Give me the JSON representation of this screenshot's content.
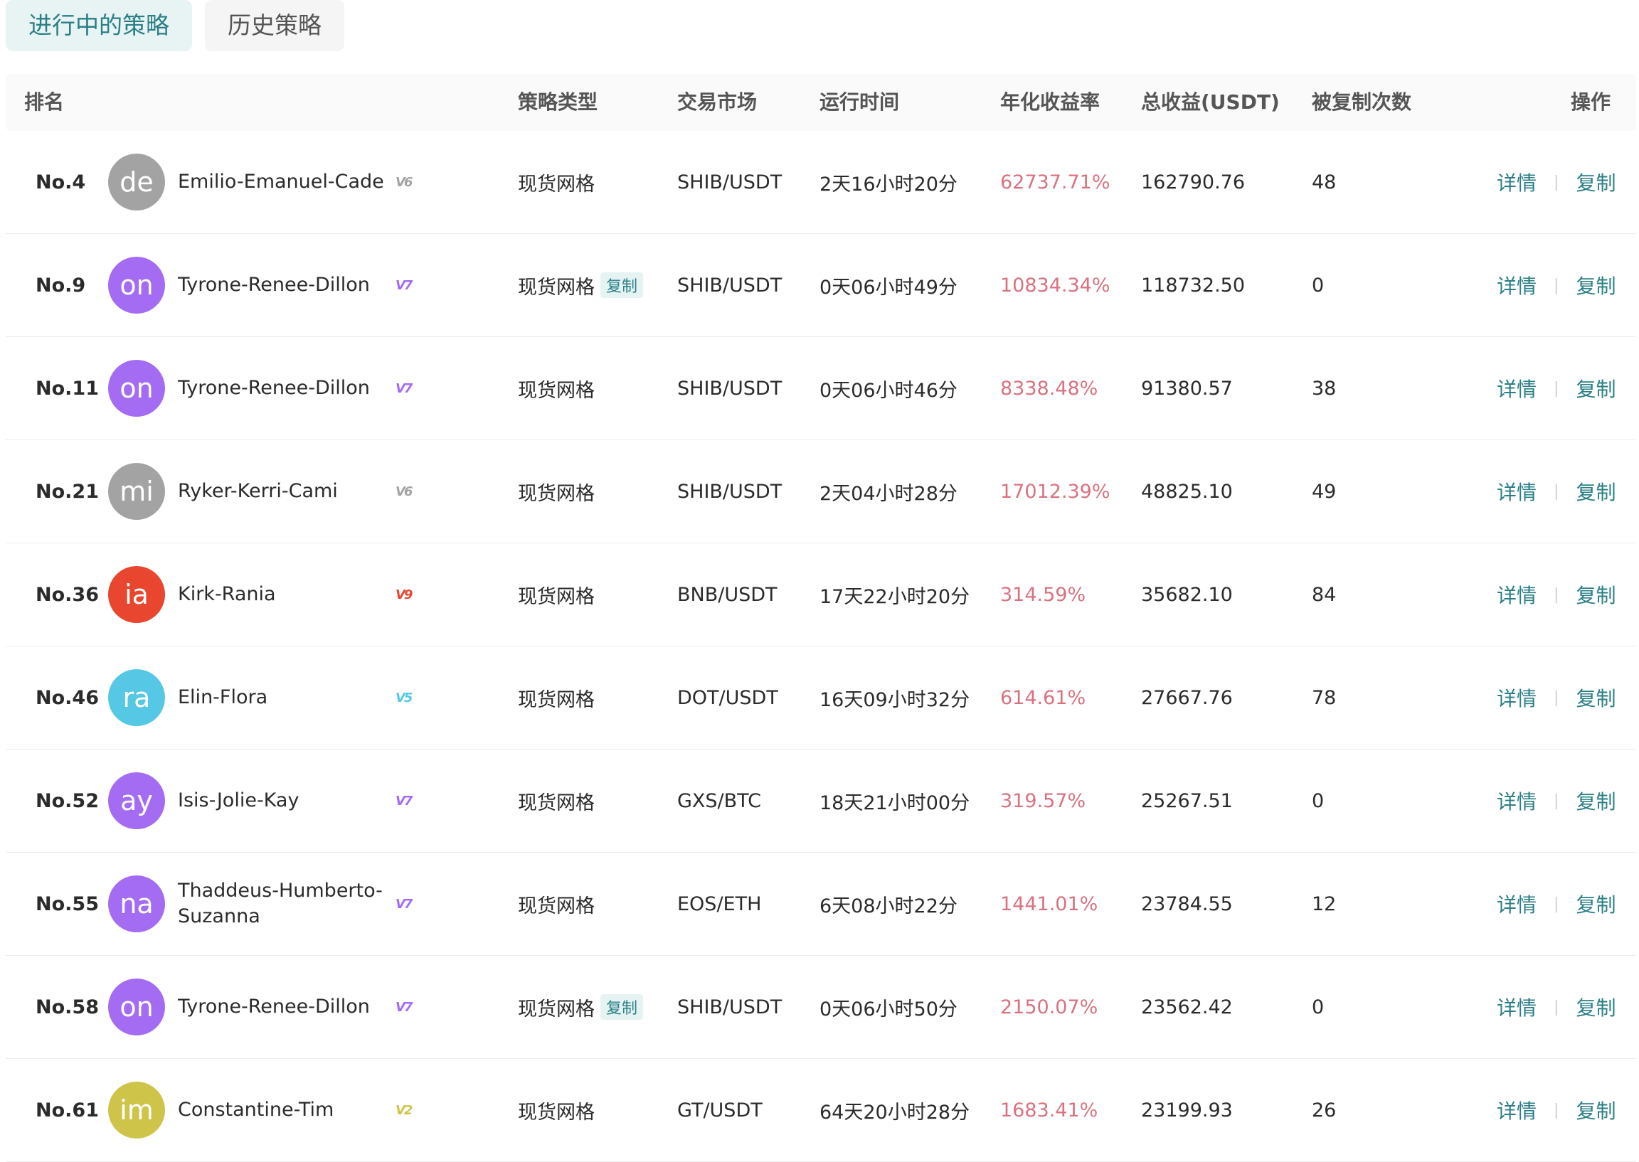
{
  "tabs": [
    {
      "label": "进行中的策略",
      "active": true
    },
    {
      "label": "历史策略",
      "active": false
    }
  ],
  "columns": {
    "rank": "排名",
    "type": "策略类型",
    "market": "交易市场",
    "runtime": "运行时间",
    "yield": "年化收益率",
    "profit": "总收益(USDT)",
    "copies": "被复制次数",
    "actions": "操作"
  },
  "actions": {
    "detail": "详情",
    "copy": "复制"
  },
  "copy_tag": "复制",
  "colors": {
    "accent": "#2a7f86",
    "yield": "#d9727f"
  },
  "rows": [
    {
      "rank": "No.4",
      "avatar": "de",
      "avatar_color": "#a3a3a3",
      "name": "Emilio-Emanuel-Cade",
      "level": "V6",
      "level_color": "#a3a3a3",
      "type": "现货网格",
      "copy_tag": false,
      "market": "SHIB/USDT",
      "runtime": "2天16小时20分",
      "yield": "62737.71%",
      "profit": "162790.76",
      "copies": "48"
    },
    {
      "rank": "No.9",
      "avatar": "on",
      "avatar_color": "#a46cf2",
      "name": "Tyrone-Renee-Dillon",
      "level": "V7",
      "level_color": "#a46cf2",
      "type": "现货网格",
      "copy_tag": true,
      "market": "SHIB/USDT",
      "runtime": "0天06小时49分",
      "yield": "10834.34%",
      "profit": "118732.50",
      "copies": "0"
    },
    {
      "rank": "No.11",
      "avatar": "on",
      "avatar_color": "#a46cf2",
      "name": "Tyrone-Renee-Dillon",
      "level": "V7",
      "level_color": "#a46cf2",
      "type": "现货网格",
      "copy_tag": false,
      "market": "SHIB/USDT",
      "runtime": "0天06小时46分",
      "yield": "8338.48%",
      "profit": "91380.57",
      "copies": "38"
    },
    {
      "rank": "No.21",
      "avatar": "mi",
      "avatar_color": "#a3a3a3",
      "name": "Ryker-Kerri-Cami",
      "level": "V6",
      "level_color": "#a3a3a3",
      "type": "现货网格",
      "copy_tag": false,
      "market": "SHIB/USDT",
      "runtime": "2天04小时28分",
      "yield": "17012.39%",
      "profit": "48825.10",
      "copies": "49"
    },
    {
      "rank": "No.36",
      "avatar": "ia",
      "avatar_color": "#e8462e",
      "name": "Kirk-Rania",
      "level": "V9",
      "level_color": "#e8462e",
      "type": "现货网格",
      "copy_tag": false,
      "market": "BNB/USDT",
      "runtime": "17天22小时20分",
      "yield": "314.59%",
      "profit": "35682.10",
      "copies": "84"
    },
    {
      "rank": "No.46",
      "avatar": "ra",
      "avatar_color": "#56c8e6",
      "name": "Elin-Flora",
      "level": "V5",
      "level_color": "#56c8e6",
      "type": "现货网格",
      "copy_tag": false,
      "market": "DOT/USDT",
      "runtime": "16天09小时32分",
      "yield": "614.61%",
      "profit": "27667.76",
      "copies": "78"
    },
    {
      "rank": "No.52",
      "avatar": "ay",
      "avatar_color": "#a46cf2",
      "name": "Isis-Jolie-Kay",
      "level": "V7",
      "level_color": "#a46cf2",
      "type": "现货网格",
      "copy_tag": false,
      "market": "GXS/BTC",
      "runtime": "18天21小时00分",
      "yield": "319.57%",
      "profit": "25267.51",
      "copies": "0"
    },
    {
      "rank": "No.55",
      "avatar": "na",
      "avatar_color": "#a46cf2",
      "name": "Thaddeus-Humberto-Suzanna",
      "level": "V7",
      "level_color": "#a46cf2",
      "type": "现货网格",
      "copy_tag": false,
      "market": "EOS/ETH",
      "runtime": "6天08小时22分",
      "yield": "1441.01%",
      "profit": "23784.55",
      "copies": "12"
    },
    {
      "rank": "No.58",
      "avatar": "on",
      "avatar_color": "#a46cf2",
      "name": "Tyrone-Renee-Dillon",
      "level": "V7",
      "level_color": "#a46cf2",
      "type": "现货网格",
      "copy_tag": true,
      "market": "SHIB/USDT",
      "runtime": "0天06小时50分",
      "yield": "2150.07%",
      "profit": "23562.42",
      "copies": "0"
    },
    {
      "rank": "No.61",
      "avatar": "im",
      "avatar_color": "#cfc44a",
      "name": "Constantine-Tim",
      "level": "V2",
      "level_color": "#cfc44a",
      "type": "现货网格",
      "copy_tag": false,
      "market": "GT/USDT",
      "runtime": "64天20小时28分",
      "yield": "1683.41%",
      "profit": "23199.93",
      "copies": "26"
    }
  ]
}
